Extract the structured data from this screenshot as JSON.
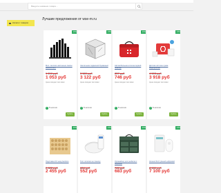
{
  "header": {
    "search_placeholder": "Введите название товара ...",
    "category_button": "Каталог товаров"
  },
  "main": {
    "title": "Лучшие предложения от wse-m.ru"
  },
  "colors": {
    "accent_yellow": "#f3e64f",
    "price_red": "#e3322f",
    "badge_green": "#2dab5e",
    "buy_green": "#7bb33c"
  },
  "products": [
    {
      "badge": "-13%",
      "description": "Мол. палочки настенные лампы BAWGOSHT",
      "old_price": "1 210 руб",
      "price": "1 053 руб",
      "watch": "Цена ожидает вас вами",
      "instock": "В наличии",
      "buy": "Купить",
      "image": "black-bars"
    },
    {
      "badge": "-13%",
      "description": "Светильник подвесной бумажный",
      "old_price": "3 589 руб",
      "price": "3 122 руб",
      "watch": "Цена ожидает вас вами",
      "instock": "В наличии",
      "buy": "Купить",
      "image": "lamp-cube"
    },
    {
      "badge": "-13%",
      "description": "Автомобильная аптечка первой помощи",
      "old_price": "857 руб",
      "price": "746 руб",
      "watch": "Цена ожидает вас вами",
      "instock": "В наличии",
      "buy": "Купить",
      "image": "red-bag"
    },
    {
      "badge": "-13%",
      "description": "Детская аптечка сумка медицинская",
      "old_price": "4 503 руб",
      "price": "3 918 руб",
      "watch": "Цена ожидает вас вами",
      "instock": "В наличии",
      "buy": "Купить",
      "image": "medkit"
    },
    {
      "badge": "-13%",
      "description": "Подставка 60 гнезд bamboo",
      "old_price": "2 822 руб",
      "price": "2 455 руб",
      "image": "bamboo"
    },
    {
      "badge": "-13%",
      "description": "Тест-полоски на глюкозу",
      "old_price": "634 руб",
      "price": "552 руб",
      "image": "strips"
    },
    {
      "badge": "-13%",
      "description": "Органайзер для рыбалки с ящиками",
      "old_price": "785 руб",
      "price": "683 руб",
      "image": "tackle-box"
    },
    {
      "badge": "-13%",
      "description": "Ночник Wi-Fi умный цифровой",
      "old_price": "8 161 руб",
      "price": "7 100 руб",
      "image": "lamp-white"
    }
  ]
}
